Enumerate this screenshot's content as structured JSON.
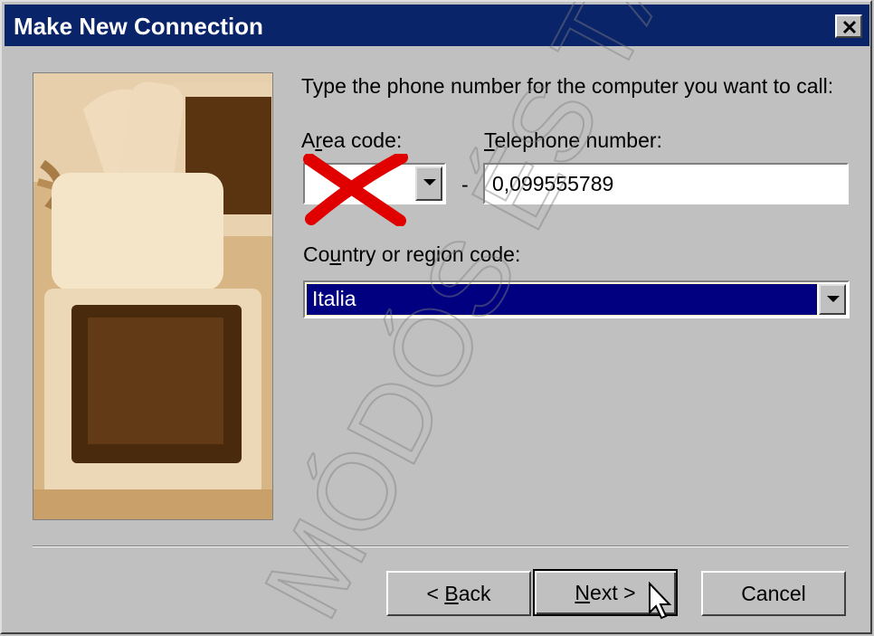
{
  "window": {
    "title": "Make New Connection"
  },
  "instructions": "Type the phone number for the computer you want to call:",
  "area_code": {
    "label_prefix": "A",
    "label_access": "r",
    "label_rest": "ea code:",
    "value": ""
  },
  "phone": {
    "label_access": "T",
    "label_rest": "elephone number:",
    "value": "0,099555789",
    "separator": "-"
  },
  "country": {
    "label_prefix": "Co",
    "label_access": "u",
    "label_rest": "ntry or region code:",
    "value": "Italia"
  },
  "buttons": {
    "back_prefix": "< ",
    "back_access": "B",
    "back_rest": "ack",
    "next_access": "N",
    "next_rest": "ext >",
    "cancel": "Cancel"
  },
  "watermark": "MÓDÓS ÉS TÁRSA",
  "colors": {
    "titlebar": "#0a246a",
    "selection": "#000080",
    "dialog": "#c0c0c0",
    "annotation": "#e00000"
  }
}
